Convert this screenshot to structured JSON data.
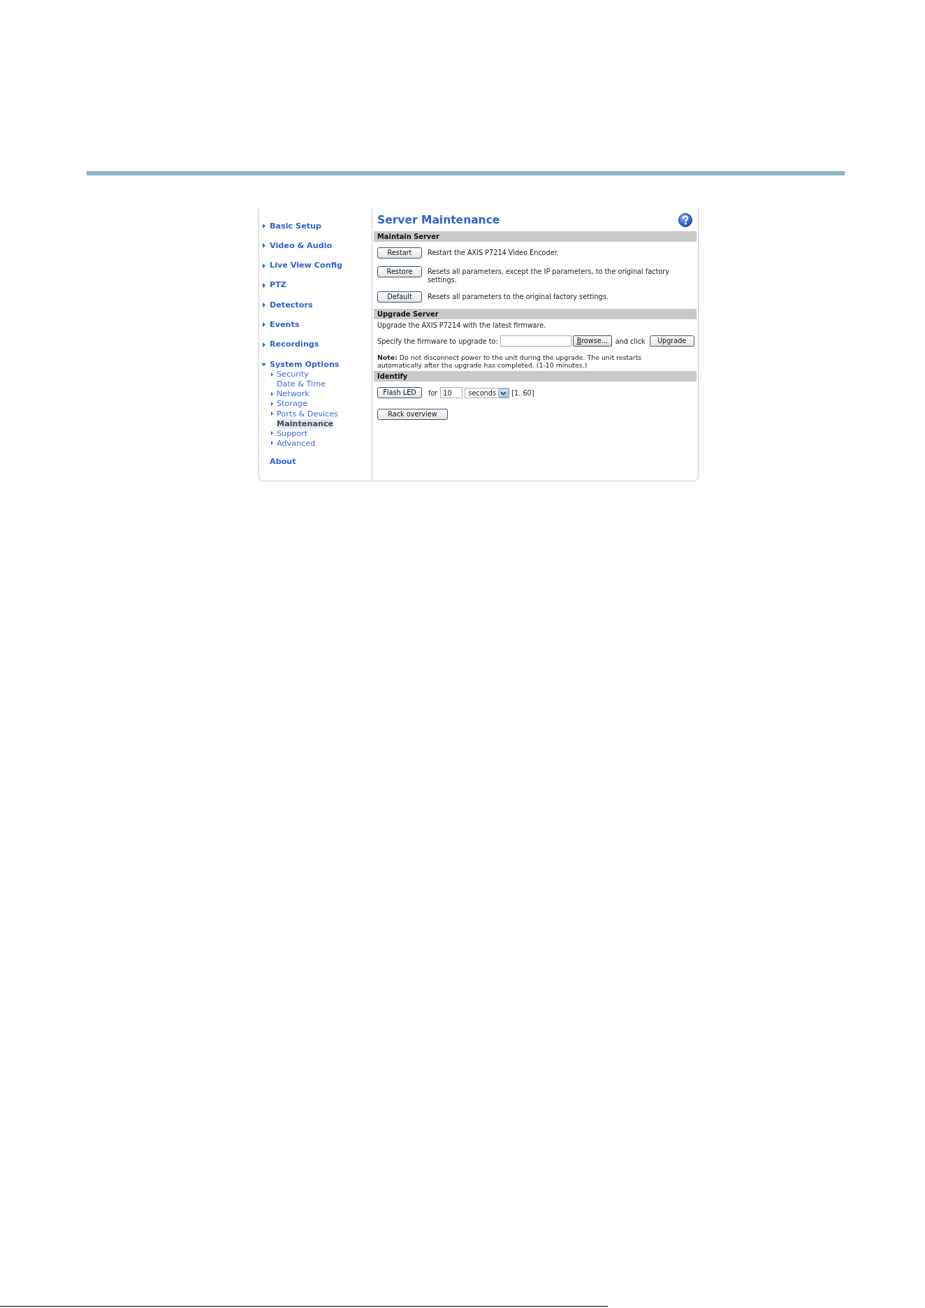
{
  "sidebar": {
    "items": [
      {
        "label": "Basic Setup",
        "kind": "menu",
        "expanded": false
      },
      {
        "label": "Video & Audio",
        "kind": "menu",
        "expanded": false
      },
      {
        "label": "Live View Config",
        "kind": "menu",
        "expanded": false
      },
      {
        "label": "PTZ",
        "kind": "menu",
        "expanded": false
      },
      {
        "label": "Detectors",
        "kind": "menu",
        "expanded": false
      },
      {
        "label": "Events",
        "kind": "menu",
        "expanded": false
      },
      {
        "label": "Recordings",
        "kind": "menu",
        "expanded": false
      },
      {
        "label": "System Options",
        "kind": "menu",
        "expanded": true,
        "children": [
          {
            "label": "Security",
            "kind": "menu",
            "selected": false
          },
          {
            "label": "Date & Time",
            "kind": "page",
            "selected": false
          },
          {
            "label": "Network",
            "kind": "menu",
            "selected": false
          },
          {
            "label": "Storage",
            "kind": "menu",
            "selected": false
          },
          {
            "label": "Ports & Devices",
            "kind": "menu",
            "selected": false
          },
          {
            "label": "Maintenance",
            "kind": "page",
            "selected": true
          },
          {
            "label": "Support",
            "kind": "menu",
            "selected": false
          },
          {
            "label": "Advanced",
            "kind": "menu",
            "selected": false
          }
        ]
      },
      {
        "label": "About",
        "kind": "link"
      }
    ]
  },
  "page": {
    "title": "Server Maintenance"
  },
  "maintain_server": {
    "heading": "Maintain Server",
    "actions": [
      {
        "button": "Restart",
        "description": "Restart the AXIS P7214 Video Encoder."
      },
      {
        "button": "Restore",
        "description": "Resets all parameters, except the IP parameters, to the original factory settings."
      },
      {
        "button": "Default",
        "description": "Resets all parameters to the original factory settings."
      }
    ]
  },
  "upgrade_server": {
    "heading": "Upgrade Server",
    "intro": "Upgrade the AXIS P7214 with the latest firmware.",
    "file_label": "Specify the firmware to upgrade to:",
    "browse_button": "Browse...",
    "and_click": "and click",
    "upgrade_button": "Upgrade",
    "note": "**Note:** Do not disconnect power to the unit during the upgrade. The unit restarts automatically after the upgrade has completed. (1-10 minutes.)"
  },
  "identify": {
    "heading": "Identify",
    "flash_button": "Flash LED",
    "for_label": "for",
    "duration": "10",
    "unit": "seconds",
    "range": "[1..60]",
    "rack_button": "Rack overview"
  }
}
